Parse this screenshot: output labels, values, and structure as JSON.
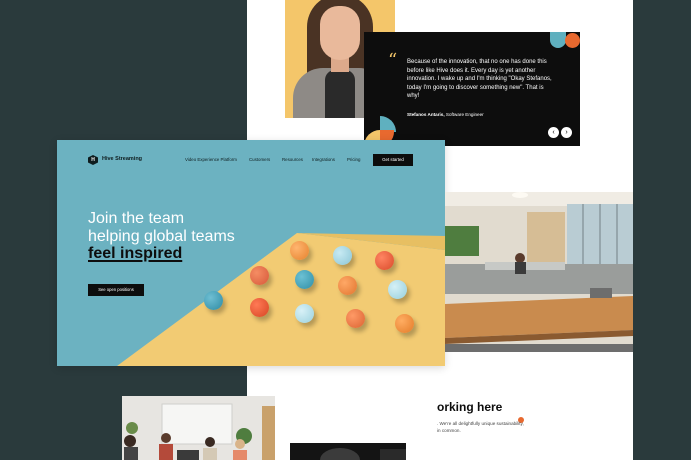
{
  "testimonial": {
    "quote_mark": "“",
    "quote": "Because of the innovation, that no one has done this before like Hive does it. Every day is yet another innovation. I wake up and I'm thinking \"Okay Stefanos, today I'm going to discover something new\". That is why!",
    "author_name": "Stefanos Antaris,",
    "author_role": "Software Engineer",
    "prev_icon": "‹",
    "next_icon": "›"
  },
  "hero": {
    "logo_mark": "H",
    "logo_text": "Hive Streaming",
    "nav": [
      "Video Experience Platform",
      "Customers",
      "Resources",
      "Integrations",
      "Pricing"
    ],
    "cta_top": "Get started",
    "headline_line1": "Join the team",
    "headline_line2": "helping global teams",
    "headline_accent": "feel inspired",
    "cta_positions": "See open positions"
  },
  "working": {
    "title": "orking here",
    "subtitle": ". We're all delightfully unique sustainability, in common."
  },
  "colors": {
    "dark_panel": "#2a3a3c",
    "teal": "#6cb2c1",
    "yellow": "#f4c66a",
    "orange": "#e8692f",
    "black": "#0d0d0d"
  }
}
